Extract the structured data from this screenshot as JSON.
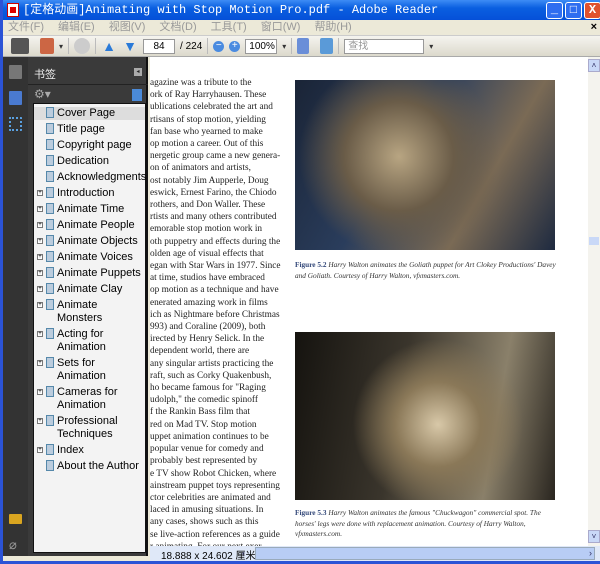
{
  "window": {
    "title": "[定格动画]Animating with Stop Motion Pro.pdf - Adobe Reader",
    "minimize": "_",
    "maximize": "□",
    "close": "X"
  },
  "menu": [
    "文件(F)",
    "编辑(E)",
    "视图(V)",
    "文档(D)",
    "工具(T)",
    "窗口(W)",
    "帮助(H)"
  ],
  "menu_close": "×",
  "toolbar": {
    "page_current": "84",
    "page_total": "/ 224",
    "zoom": "100%",
    "search_placeholder": "查找"
  },
  "bookmarks": {
    "title": "书签",
    "items": [
      {
        "label": "Cover Page",
        "expandable": false,
        "selected": true
      },
      {
        "label": "Title page",
        "expandable": false
      },
      {
        "label": "Copyright page",
        "expandable": false
      },
      {
        "label": "Dedication",
        "expandable": false
      },
      {
        "label": "Acknowledgments",
        "expandable": false
      },
      {
        "label": "Introduction",
        "expandable": true
      },
      {
        "label": "Animate Time",
        "expandable": true
      },
      {
        "label": "Animate People",
        "expandable": true
      },
      {
        "label": "Animate Objects",
        "expandable": true
      },
      {
        "label": "Animate Voices",
        "expandable": true
      },
      {
        "label": "Animate Puppets",
        "expandable": true
      },
      {
        "label": "Animate Clay",
        "expandable": true
      },
      {
        "label": "Animate Monsters",
        "expandable": true
      },
      {
        "label": "Acting for Animation",
        "expandable": true
      },
      {
        "label": "Sets for Animation",
        "expandable": true
      },
      {
        "label": "Cameras for Animation",
        "expandable": true
      },
      {
        "label": "Professional Techniques",
        "expandable": true
      },
      {
        "label": "Index",
        "expandable": true
      },
      {
        "label": "About the Author",
        "expandable": false
      }
    ]
  },
  "document": {
    "text_lines": [
      "agazine was a tribute to the",
      "ork of Ray Harryhausen. These",
      "ublications celebrated the art and",
      "rtisans of stop motion, yielding",
      "fan base who yearned to make",
      "op motion a career. Out of this",
      "nergetic group came a new genera-",
      "on of animators and artists,",
      "ost notably Jim Aupperle, Doug",
      "eswick, Ernest Farino, the Chiodo",
      "rothers, and Don Waller. These",
      "rtists and many others contributed",
      "emorable stop motion work in",
      "oth puppetry and effects during the",
      "olden age of visual effects that",
      "egan with Star Wars in 1977. Since",
      "at time, studios have embraced",
      "op motion as a technique and have",
      "enerated amazing work in films",
      "ich as Nightmare before Christmas",
      "993) and Coraline (2009), both",
      "irected by Henry Selick. In the",
      "dependent world, there are",
      "any singular artists practicing the",
      "raft, such as Corky Quakenbush,",
      "ho became famous for \"Raging",
      "udolph,\" the comedic spinoff",
      "f the Rankin Bass film that",
      "red on Mad TV. Stop motion",
      "uppet animation continues to be",
      "popular venue for comedy and",
      "probably best represented by",
      "e TV show Robot Chicken, where",
      "ainstream puppet toys representing",
      "ctor celebrities are animated and",
      "laced in amusing situations. In",
      "any cases, shows such as this",
      "se live-action references as a guide",
      "r animating. For our next exer-"
    ],
    "fig1": {
      "label": "Figure 5.2",
      "caption": "Harry Walton animates the Goliath puppet for Art Clokey Productions' Davey and Goliath. Courtesy of Harry Walton, vfxmasters.com."
    },
    "fig2": {
      "label": "Figure 5.3",
      "caption": "Harry Walton animates the famous \"Chuckwagon\" commercial spot. The horses' legs were done with replacement animation. Courtesy of Harry Walton, vfxmasters.com."
    }
  },
  "status": {
    "page_size": "18.888 x 24.602 厘米"
  }
}
